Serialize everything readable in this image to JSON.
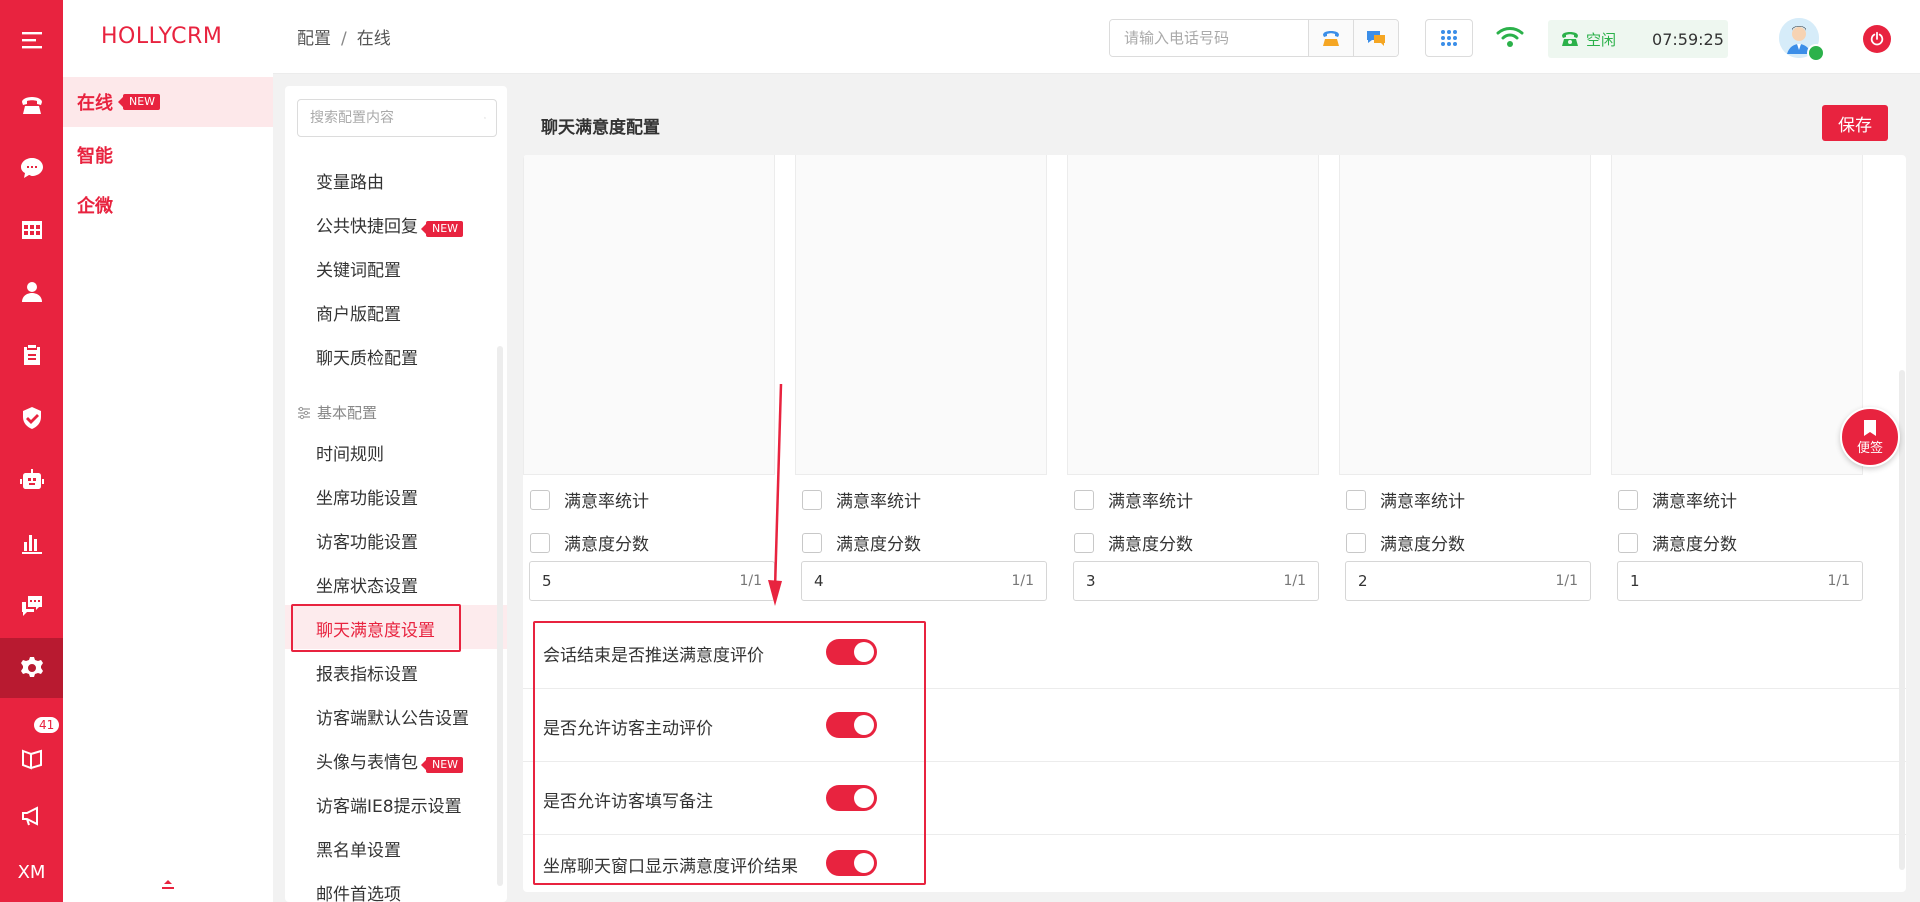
{
  "rail": {
    "mail_badge": "41",
    "user_initials": "XM"
  },
  "brand": "HOLLYCRM",
  "nav2": {
    "items": [
      {
        "label": "在线",
        "tag": "NEW",
        "active": true
      },
      {
        "label": "智能"
      },
      {
        "label": "企微"
      }
    ]
  },
  "header": {
    "breadcrumb": [
      "配置",
      "在线"
    ],
    "phone_placeholder": "请输入电话号码",
    "status_label": "空闲",
    "status_time": "07:59:25"
  },
  "config_list": {
    "search_placeholder": "搜索配置内容",
    "group_label": "基本配置",
    "items_top": [
      {
        "label": "变量路由"
      },
      {
        "label": "公共快捷回复",
        "tag": "NEW"
      },
      {
        "label": "关键词配置"
      },
      {
        "label": "商户版配置"
      },
      {
        "label": "聊天质检配置"
      }
    ],
    "items_basic": [
      {
        "label": "时间规则"
      },
      {
        "label": "坐席功能设置"
      },
      {
        "label": "访客功能设置"
      },
      {
        "label": "坐席状态设置"
      },
      {
        "label": "聊天满意度设置",
        "active": true
      },
      {
        "label": "报表指标设置"
      },
      {
        "label": "访客端默认公告设置"
      },
      {
        "label": "头像与表情包",
        "tag": "NEW"
      },
      {
        "label": "访客端IE8提示设置"
      },
      {
        "label": "黑名单设置"
      },
      {
        "label": "邮件首选项"
      }
    ]
  },
  "main": {
    "title": "聊天满意度配置",
    "save_label": "保存",
    "levels": [
      {
        "stat_label": "满意率统计",
        "score_label": "满意度分数",
        "value": "5",
        "count": "1/1"
      },
      {
        "stat_label": "满意率统计",
        "score_label": "满意度分数",
        "value": "4",
        "count": "1/1"
      },
      {
        "stat_label": "满意率统计",
        "score_label": "满意度分数",
        "value": "3",
        "count": "1/1"
      },
      {
        "stat_label": "满意率统计",
        "score_label": "满意度分数",
        "value": "2",
        "count": "1/1"
      },
      {
        "stat_label": "满意率统计",
        "score_label": "满意度分数",
        "value": "1",
        "count": "1/1"
      }
    ],
    "switches": [
      {
        "label": "会话结束是否推送满意度评价",
        "on": true
      },
      {
        "label": "是否允许访客主动评价",
        "on": true
      },
      {
        "label": "是否允许访客填写备注",
        "on": true
      },
      {
        "label": "坐席聊天窗口显示满意度评价结果",
        "on": true
      }
    ]
  },
  "sticky_note": {
    "label": "便签"
  },
  "colors": {
    "accent": "#e8233f",
    "status_green": "#2bb14a"
  }
}
